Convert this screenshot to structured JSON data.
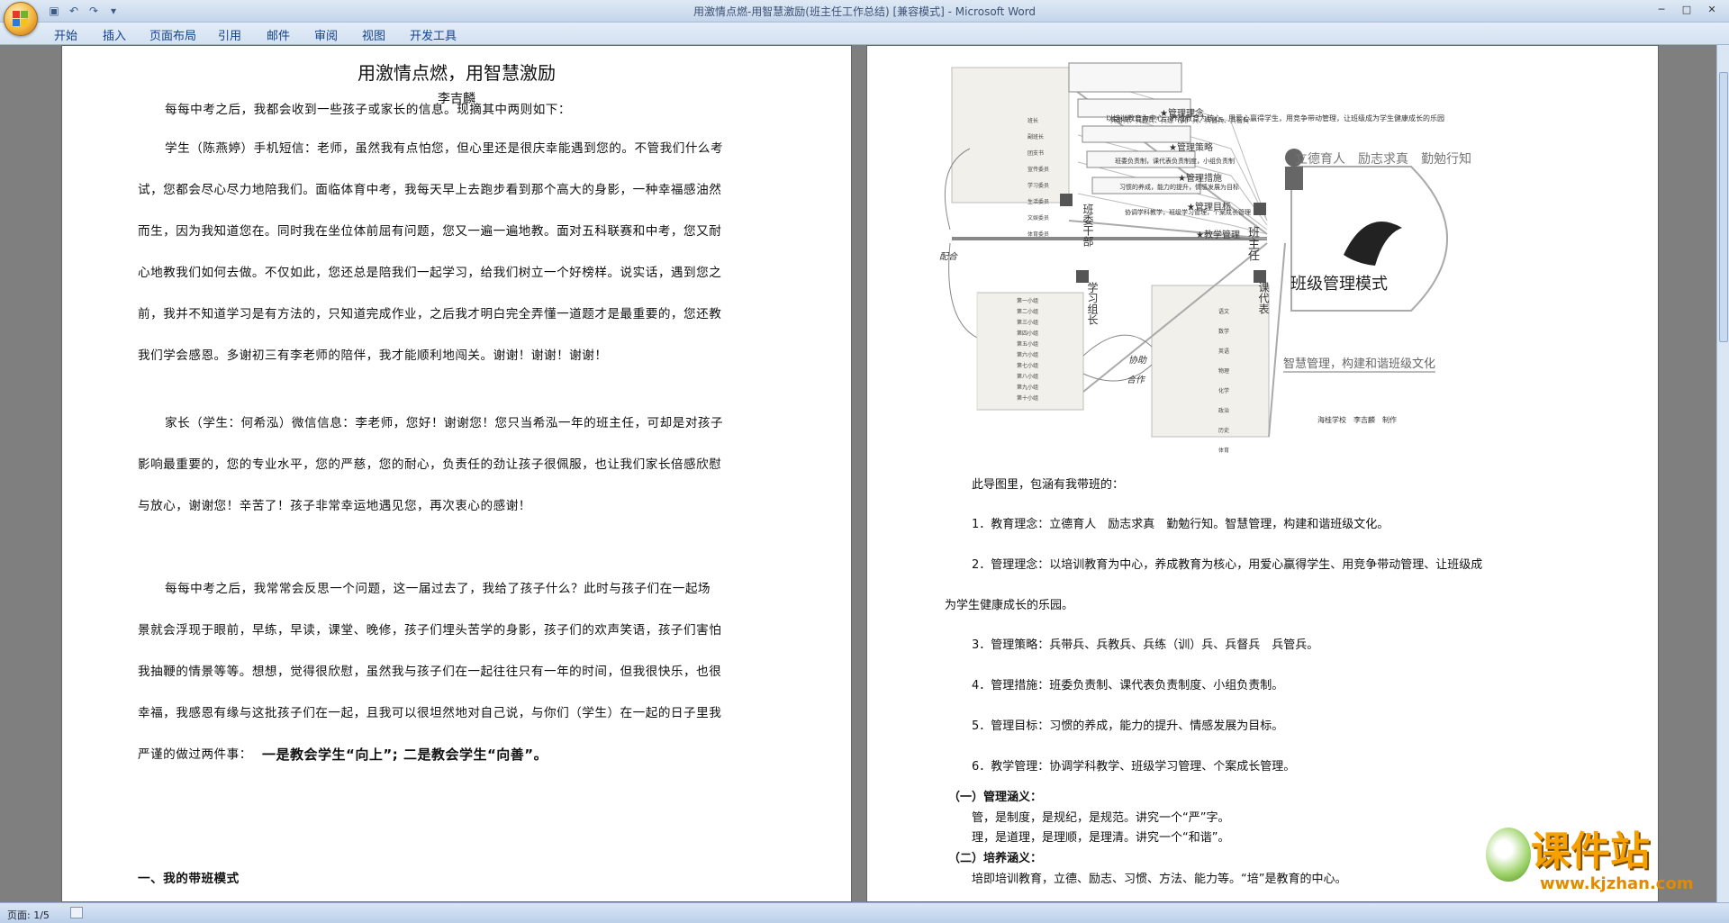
{
  "window": {
    "title": "用激情点燃-用智慧激励(班主任工作总结) [兼容模式] - Microsoft Word"
  },
  "menu": [
    "开始",
    "插入",
    "页面布局",
    "引用",
    "邮件",
    "审阅",
    "视图",
    "开发工具"
  ],
  "status": {
    "page": "页面: 1/5"
  },
  "left": {
    "title": "用激情点燃，用智慧激励",
    "author": "李吉麟",
    "lines": [
      "每每中考之后，我都会收到一些孩子或家长的信息。现摘其中两则如下：",
      "学生（陈燕婷）手机短信：老师，虽然我有点怕您，但心里还是很庆幸能遇到您的。不管我们什么考",
      "试，您都会尽心尽力地陪我们。面临体育中考，我每天早上去跑步看到那个高大的身影，一种幸福感油然",
      "而生，因为我知道您在。同时我在坐位体前屈有问题，您又一遍一遍地教。面对五科联赛和中考，您又耐",
      "心地教我们如何去做。不仅如此，您还总是陪我们一起学习，给我们树立一个好榜样。说实话，遇到您之",
      "前，我并不知道学习是有方法的，只知道完成作业，之后我才明白完全弄懂一道题才是最重要的，您还教",
      "我们学会感恩。多谢初三有李老师的陪伴，我才能顺利地闯关。谢谢！谢谢！谢谢！",
      "家长（学生：何希泓）微信信息：李老师，您好！谢谢您！您只当希泓一年的班主任，可却是对孩子",
      "影响最重要的，您的专业水平，您的严慈，您的耐心，负责任的劲让孩子很佩服，也让我们家长倍感欣慰",
      "与放心，谢谢您！辛苦了！孩子非常幸运地遇见您，再次衷心的感谢！",
      "每每中考之后，我常常会反思一个问题，这一届过去了，我给了孩子什么？此时与孩子们在一起场",
      "景就会浮现于眼前，早练，早读，课堂、晚修，孩子们埋头苦学的身影，孩子们的欢声笑语，孩子们害怕",
      "我抽鞭的情景等等。想想，觉得很欣慰，虽然我与孩子们在一起往往只有一年的时间，但我很快乐，也很",
      "幸福，我感恩有缘与这批孩子们在一起，且我可以很坦然地对自己说，与你们（学生）在一起的日子里我",
      "严谨的做过两件事：",
      "一是教会学生“向上”; 二是教会学生“向善”。",
      "一、我的带班模式"
    ]
  },
  "right": {
    "diagram": {
      "center": "班级管理模式",
      "motto": "立德育人　励志求真　勤勉行知",
      "slogan": "智慧管理，构建和谐班级文化",
      "credit": "海桂学校　李吉麟　制作",
      "branches": [
        "★管理理念",
        "★管理策略",
        "★管理措施",
        "★管理目标",
        "★教学管理"
      ],
      "labels": [
        "班主任",
        "班委干部",
        "课代表",
        "学习组长"
      ],
      "links": [
        "配合",
        "协助",
        "合作"
      ],
      "notes": [
        "以培训教育为中心，养成教育为核心，用爱心赢得学生，用竞争带动管理，让班级成为学生健康成长的乐园",
        "兵带兵、兵教兵、兵练（训）兵、兵督兵、兵管兵",
        "班委负责制，课代表负责制度，小组负责制",
        "习惯的养成，能力的提升，情感发展为目标",
        "协调学科教学，班级学习管理，个案成长管理"
      ],
      "cadres": [
        "班长",
        "副班长",
        "团支书",
        "宣传委员",
        "学习委员",
        "生活委员",
        "文娱委员",
        "体育委员"
      ],
      "subjects": [
        "语文",
        "数学",
        "英语",
        "物理",
        "化学",
        "政治",
        "历史",
        "体育"
      ],
      "groups": [
        "第一小组",
        "第二小组",
        "第三小组",
        "第四小组",
        "第五小组",
        "第六小组",
        "第七小组",
        "第八小组",
        "第九小组",
        "第十小组"
      ]
    },
    "lines": [
      "此导图里，包涵有我带班的：",
      "1．教育理念：立德育人　励志求真　勤勉行知。智慧管理，构建和谐班级文化。",
      "2．管理理念：以培训教育为中心，养成教育为核心，用爱心赢得学生、用竞争带动管理、让班级成",
      "为学生健康成长的乐园。",
      "3．管理策略：兵带兵、兵教兵、兵练（训）兵、兵督兵　兵管兵。",
      "4．管理措施：班委负责制、课代表负责制度、小组负责制。",
      "5．管理目标：习惯的养成，能力的提升、情感发展为目标。",
      "6．教学管理：协调学科教学、班级学习管理、个案成长管理。",
      "（一）管理涵义：",
      "管，是制度，是规纪，是规范。讲究一个“严”字。",
      "理，是道理，是理顺，是理清。讲究一个“和谐”。",
      "（二）培养涵义：",
      "培即培训教育，立德、励志、习惯、方法、能力等。“培”是教育的中心。"
    ]
  },
  "watermark": {
    "brand": "课件站",
    "url": "www.kjzhan.com"
  }
}
